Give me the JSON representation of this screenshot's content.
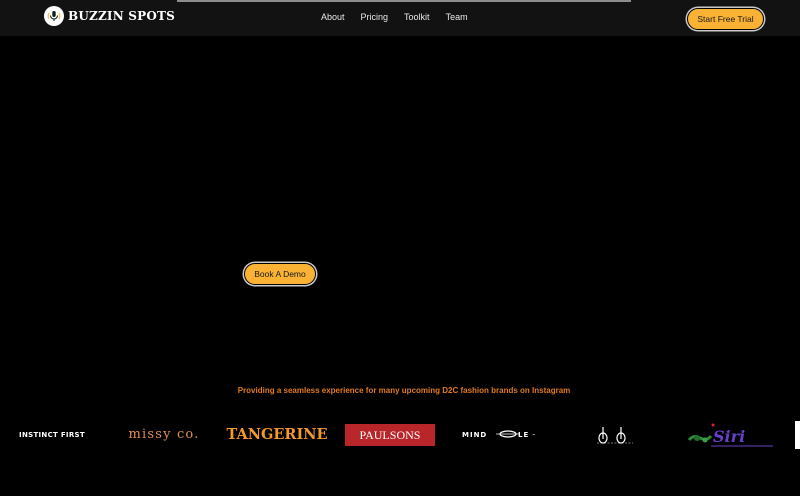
{
  "header": {
    "logo_text": "BUZZIN SPOTS",
    "nav": [
      {
        "label": "About"
      },
      {
        "label": "Pricing"
      },
      {
        "label": "Toolkit"
      },
      {
        "label": "Team"
      }
    ],
    "cta_label": "Start Free Trial"
  },
  "hero": {
    "demo_label": "Book A Demo"
  },
  "brands": {
    "tagline": "Providing a seamless experience for many upcoming D2C fashion brands on Instagram",
    "logos": [
      {
        "name": "INSTINCT FIRST"
      },
      {
        "name": "missy co."
      },
      {
        "name": "TANGERINE"
      },
      {
        "name": "PAULSONS"
      },
      {
        "name": "MINDLE"
      },
      {
        "name": "DB"
      },
      {
        "name": "Siri"
      }
    ]
  },
  "colors": {
    "accent": "#f9b234",
    "tagline": "#e07a1f",
    "background": "#000000",
    "navbar": "#121212"
  }
}
